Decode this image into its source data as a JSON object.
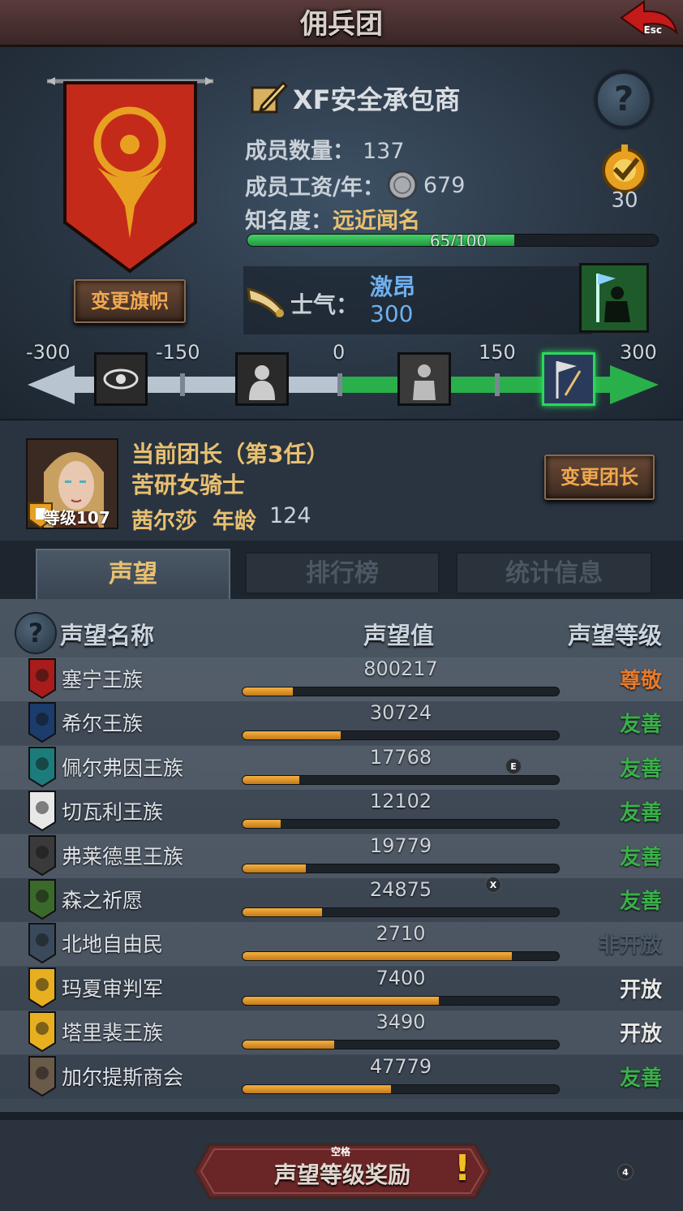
{
  "window": {
    "title": "佣兵团",
    "esc_key": "Esc"
  },
  "company": {
    "name": "XF安全承包商",
    "members_label": "成员数量：",
    "members": "137",
    "wage_label": "成员工资/年：",
    "wage": "679",
    "fame_label": "知名度：",
    "fame": "远近闻名",
    "fame_progress": "65/100",
    "fame_fraction": 0.65,
    "rank": "30",
    "change_banner_label": "变更旗帜"
  },
  "morale": {
    "label": "士气：",
    "state": "激昂",
    "value": "300",
    "scale_ticks": [
      "-300",
      "-150",
      "0",
      "150",
      "300"
    ],
    "level_fraction": 1.0,
    "active_stage": 3
  },
  "leader": {
    "title": "当前团长（第3任）",
    "class": "苦研女骑士",
    "level_label": "等级107",
    "name": "茜尔莎",
    "age_label": "年龄",
    "age": "124",
    "change_leader_label": "变更团长"
  },
  "tabs": [
    {
      "label": "声望"
    },
    {
      "label": "排行榜"
    },
    {
      "label": "统计信息"
    }
  ],
  "reputation": {
    "headers": {
      "name": "声望名称",
      "value": "声望值",
      "level": "声望等级"
    },
    "rows": [
      {
        "name": "塞宁王族",
        "value": "800217",
        "fraction": 0.16,
        "level": "尊敬",
        "color": "#e87a2a",
        "icon_color": "#a81c1c"
      },
      {
        "name": "希尔王族",
        "value": "30724",
        "fraction": 0.31,
        "level": "友善",
        "color": "#3ab04a",
        "icon_color": "#1c3c6c"
      },
      {
        "name": "佩尔弗因王族",
        "value": "17768",
        "fraction": 0.18,
        "level": "友善",
        "color": "#3ab04a",
        "icon_color": "#1c7c7c"
      },
      {
        "name": "切瓦利王族",
        "value": "12102",
        "fraction": 0.12,
        "level": "友善",
        "color": "#3ab04a",
        "icon_color": "#e8e8e8"
      },
      {
        "name": "弗莱德里王族",
        "value": "19779",
        "fraction": 0.2,
        "level": "友善",
        "color": "#3ab04a",
        "icon_color": "#3a3a3a"
      },
      {
        "name": "森之祈愿",
        "value": "24875",
        "fraction": 0.25,
        "level": "友善",
        "color": "#3ab04a",
        "icon_color": "#3a6a2a"
      },
      {
        "name": "北地自由民",
        "value": "2710",
        "fraction": 0.85,
        "level": "非开放",
        "color": "#4a5868",
        "icon_color": "#3a4a5a"
      },
      {
        "name": "玛夏审判军",
        "value": "7400",
        "fraction": 0.62,
        "level": "开放",
        "color": "#e8e8e8",
        "icon_color": "#e8b020"
      },
      {
        "name": "塔里裴王族",
        "value": "3490",
        "fraction": 0.29,
        "level": "开放",
        "color": "#e8e8e8",
        "icon_color": "#e8b020"
      },
      {
        "name": "加尔提斯商会",
        "value": "47779",
        "fraction": 0.47,
        "level": "友善",
        "color": "#3ab04a",
        "icon_color": "#6a5a4a"
      }
    ]
  },
  "hints": {
    "e": "E",
    "x": "X",
    "four": "4"
  },
  "reward": {
    "key": "空格",
    "label": "声望等级奖励",
    "alert": "!"
  }
}
